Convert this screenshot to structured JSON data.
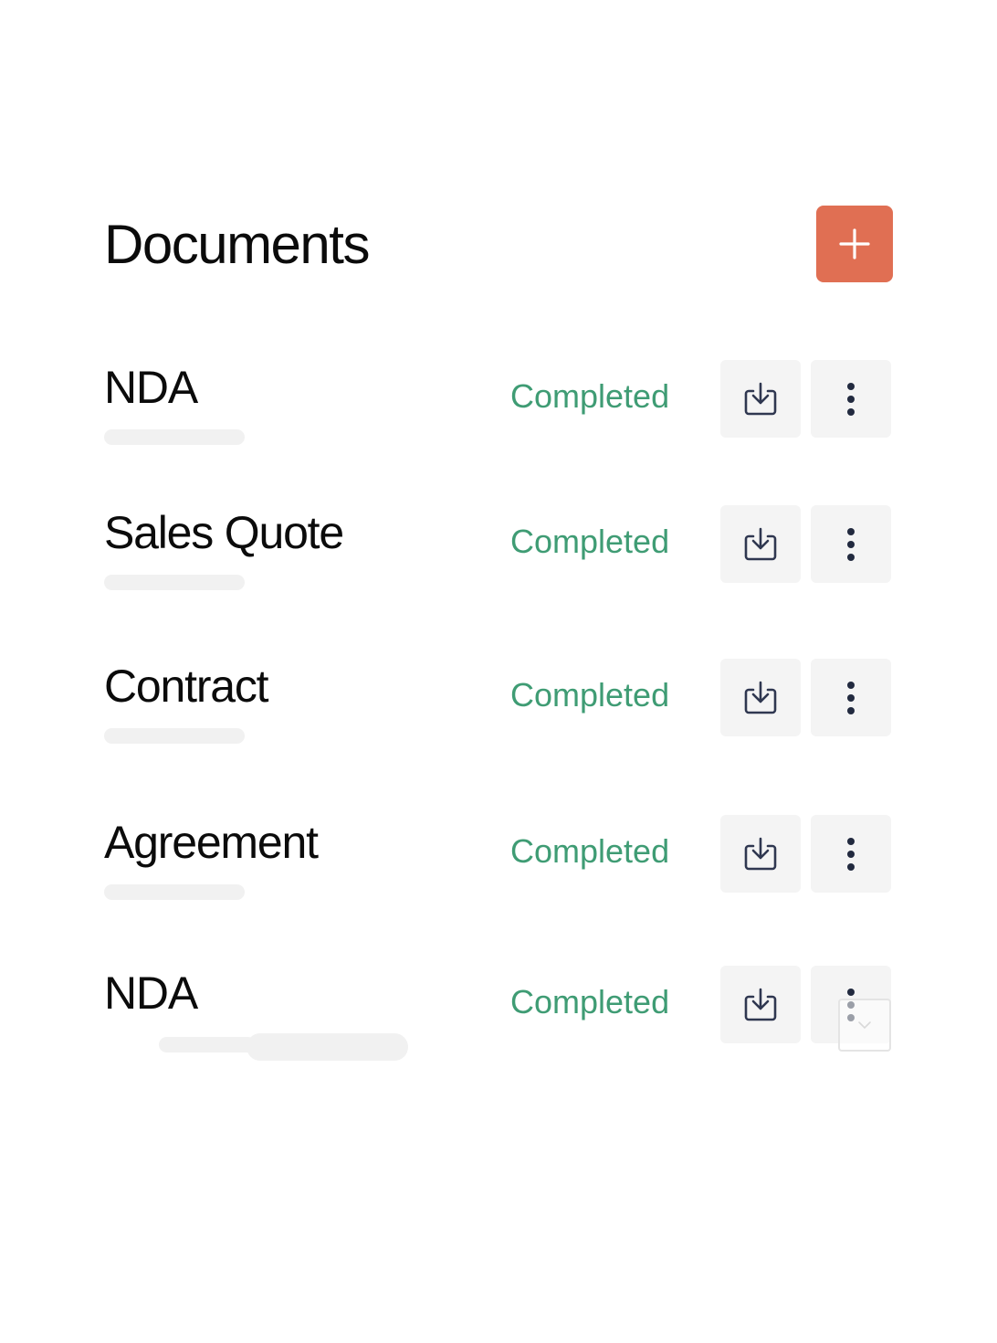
{
  "header": {
    "title": "Documents",
    "add_button_icon": "plus-icon",
    "accent_color": "#e06f53"
  },
  "documents": [
    {
      "title": "NDA",
      "status": "Completed"
    },
    {
      "title": "Sales Quote",
      "status": "Completed"
    },
    {
      "title": "Contract",
      "status": "Completed"
    },
    {
      "title": "Agreement",
      "status": "Completed"
    },
    {
      "title": "NDA",
      "status": "Completed"
    }
  ],
  "row_actions": {
    "download_icon": "download-icon",
    "more_icon": "more-vertical-icon"
  },
  "status_color": "#3f9c74"
}
